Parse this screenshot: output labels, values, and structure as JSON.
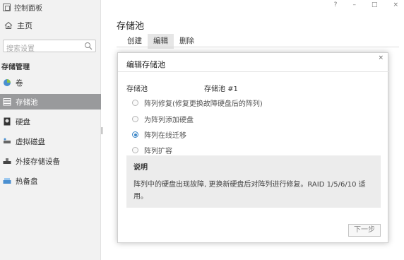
{
  "window": {
    "title": "控制面板",
    "controls": [
      "?",
      "–",
      "□",
      "×"
    ]
  },
  "sidebar": {
    "home_label": "主页",
    "search_placeholder": "搜索设置",
    "section_title": "存储管理",
    "items": [
      {
        "label": "卷",
        "icon": "volume-icon",
        "active": false
      },
      {
        "label": "存储池",
        "icon": "storage-pool-icon",
        "active": true
      },
      {
        "label": "硬盘",
        "icon": "hdd-icon",
        "active": false
      },
      {
        "label": "虚拟磁盘",
        "icon": "virtual-disk-icon",
        "active": false
      },
      {
        "label": "外接存储设备",
        "icon": "external-storage-icon",
        "active": false
      },
      {
        "label": "热备盘",
        "icon": "hot-spare-icon",
        "active": false
      }
    ]
  },
  "main": {
    "title": "存储池",
    "tabs": [
      {
        "label": "创建",
        "selected": false
      },
      {
        "label": "编辑",
        "selected": true
      },
      {
        "label": "删除",
        "selected": false
      }
    ]
  },
  "dialog": {
    "title": "编辑存储池",
    "close": "×",
    "pool_label": "存储池",
    "pool_value": "存储池 #1",
    "options": [
      {
        "label": "阵列修复(修复更换故障硬盘后的阵列)",
        "checked": false
      },
      {
        "label": "为阵列添加硬盘",
        "checked": false
      },
      {
        "label": "阵列在线迁移",
        "checked": true
      },
      {
        "label": "阵列扩容",
        "checked": false
      }
    ],
    "description_title": "说明",
    "description_line1": "阵列中的硬盘出现故障, 更换新硬盘后对阵列进行修复。RAID 1/5/6/10 适",
    "description_line2": "用。",
    "next_button": "下一步"
  },
  "colors": {
    "active_nav": "#999a9c",
    "radio_accent": "#3a86c8"
  }
}
